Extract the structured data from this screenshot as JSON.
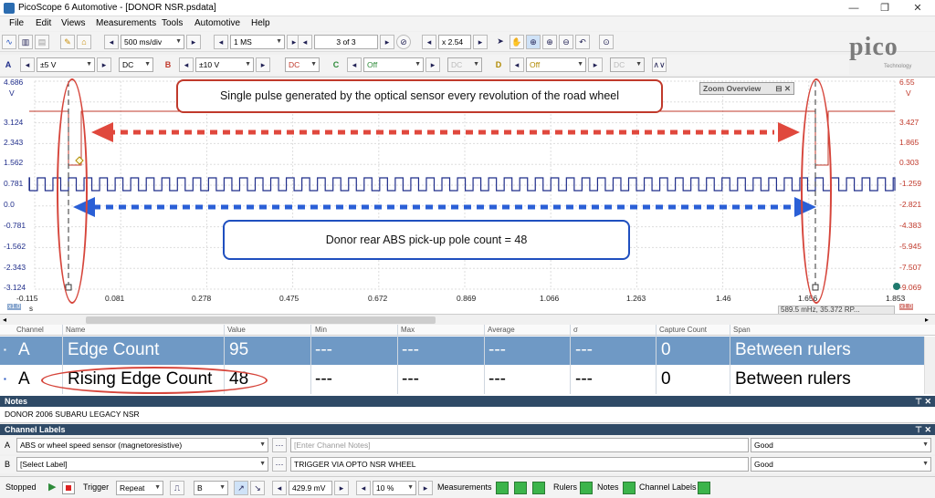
{
  "window": {
    "title": "PicoScope 6 Automotive - [DONOR NSR.psdata]",
    "minimize": "—",
    "maximize": "❐",
    "close": "✕"
  },
  "menu": [
    "File",
    "Edit",
    "Views",
    "Measurements",
    "Tools",
    "Automotive",
    "Help"
  ],
  "toolbar": {
    "timebase": "500 ms/div",
    "samples": "1 MS",
    "buffer": "3 of 3",
    "zoom": "x 2.54"
  },
  "channels_toolbar": {
    "a": {
      "tag": "A",
      "range": "±5 V",
      "coupling": "DC"
    },
    "b": {
      "tag": "B",
      "range": "±10 V",
      "coupling": "DC"
    },
    "c": {
      "tag": "C",
      "range": "Off",
      "coupling": "DC"
    },
    "d": {
      "tag": "D",
      "range": "Off",
      "coupling": "DC"
    }
  },
  "logo": {
    "text": "pico",
    "sub": "Technology"
  },
  "scope": {
    "left_axis_unit": "V",
    "right_axis_unit": "V",
    "left_ticks": [
      "4.686",
      "3.124",
      "2.343",
      "1.562",
      "0.781",
      "0.0",
      "-0.781",
      "-1.562",
      "-2.343",
      "-3.124"
    ],
    "right_ticks": [
      "6.55",
      "3.427",
      "1.865",
      "0.303",
      "-1.259",
      "-2.821",
      "-4.383",
      "-5.945",
      "-7.507",
      "-9.069"
    ],
    "x_ticks": [
      "-0.115",
      "0.081",
      "0.278",
      "0.475",
      "0.672",
      "0.869",
      "1.066",
      "1.263",
      "1.46",
      "1.656",
      "1.853"
    ],
    "x_unit": "s",
    "left_scale": "x1.0",
    "right_scale": "x1.0",
    "ruler_readout": "589.5 mHz, 35.372 RP...",
    "pulse_count": 48,
    "colors": {
      "channel_a": "#1f2d8a",
      "channel_b": "#c0392b",
      "callout_red": "#c0392b",
      "callout_blue": "#1f4fbf"
    }
  },
  "annotations": {
    "top": "Single pulse generated by the optical sensor every revolution of the road wheel",
    "bottom": "Donor rear ABS pick-up pole count = 48"
  },
  "zoom_overview": {
    "label": "Zoom Overview"
  },
  "measurements": {
    "headers": [
      "Channel",
      "Name",
      "Value",
      "Min",
      "Max",
      "Average",
      "σ",
      "Capture Count",
      "Span"
    ],
    "rows": [
      {
        "channel": "A",
        "name": "Edge Count",
        "value": "95",
        "min": "---",
        "max": "---",
        "average": "---",
        "sigma": "---",
        "capture_count": "0",
        "span": "Between rulers"
      },
      {
        "channel": "A",
        "name": "Rising Edge Count",
        "value": "48",
        "min": "---",
        "max": "---",
        "average": "---",
        "sigma": "---",
        "capture_count": "0",
        "span": "Between rulers"
      }
    ]
  },
  "notes": {
    "header": "Notes",
    "text": "DONOR 2006 SUBARU LEGACY NSR"
  },
  "channel_labels": {
    "header": "Channel Labels",
    "rows": [
      {
        "ch": "A",
        "label": "ABS or wheel speed sensor (magnetoresistive)",
        "notes": "[Enter Channel Notes]",
        "quality": "Good"
      },
      {
        "ch": "B",
        "label": "[Select Label]",
        "notes": "TRIGGER VIA OPTO NSR WHEEL",
        "quality": "Good"
      }
    ]
  },
  "status": {
    "state": "Stopped",
    "trigger_label": "Trigger",
    "trigger_mode": "Repeat",
    "trigger_channel": "B",
    "threshold": "429.9 mV",
    "pre_trigger": "10 %",
    "measurements": "Measurements",
    "rulers": "Rulers",
    "notes": "Notes",
    "channel_labels": "Channel Labels"
  }
}
